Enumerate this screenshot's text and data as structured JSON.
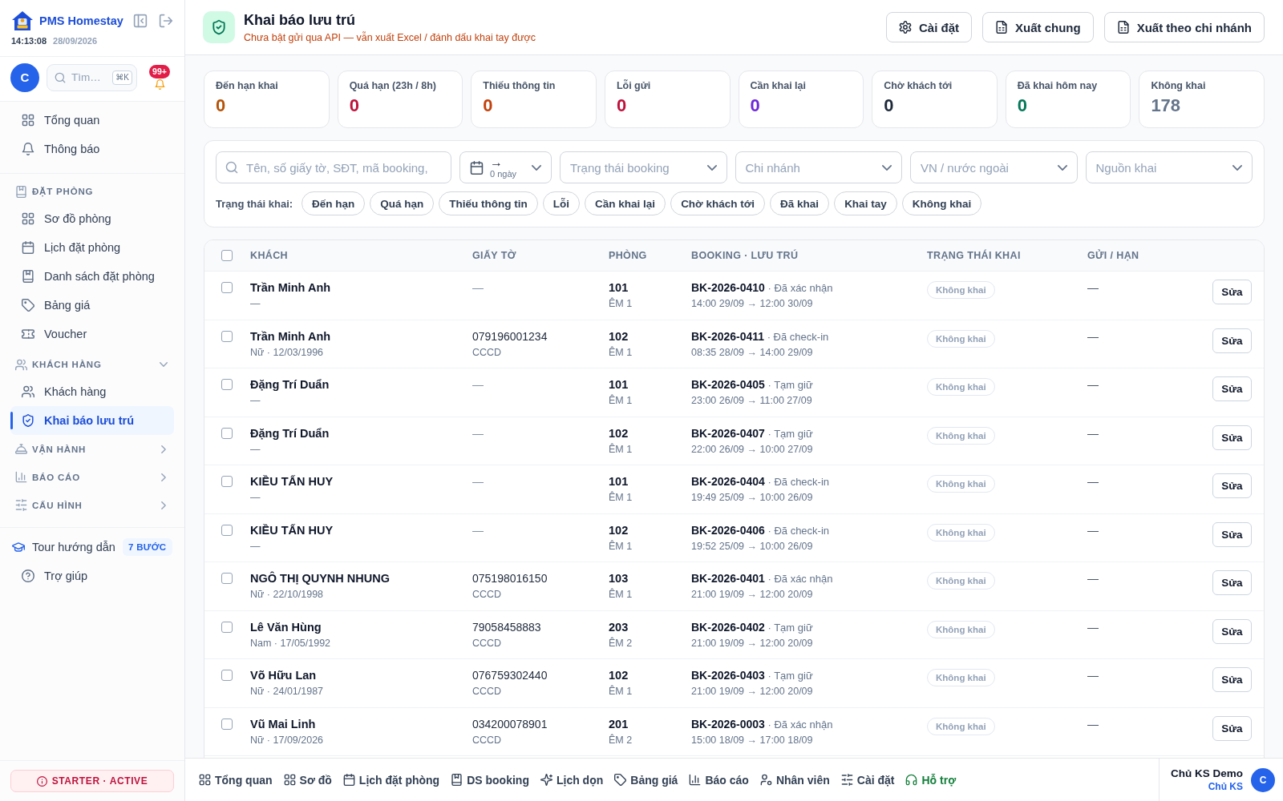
{
  "sidebar": {
    "brand": {
      "name": "PMS Homestay",
      "time": "14:13:08",
      "date": "28/09/2026"
    },
    "user": {
      "avatar": "C"
    },
    "search": {
      "placeholder": "Tìm…",
      "shortcut": "⌘K"
    },
    "notifications": {
      "badge": "99+"
    },
    "groups": [
      {
        "items": [
          {
            "label": "Tổng quan",
            "selected": false
          },
          {
            "label": "Thông báo",
            "selected": false
          }
        ]
      },
      {
        "title": "ĐẶT PHÒNG",
        "items": [
          {
            "label": "Sơ đồ phòng",
            "selected": false
          },
          {
            "label": "Lịch đặt phòng",
            "selected": false
          },
          {
            "label": "Danh sách đặt phòng",
            "selected": false
          },
          {
            "label": "Bảng giá",
            "selected": false
          },
          {
            "label": "Voucher",
            "selected": false
          }
        ]
      },
      {
        "title": "KHÁCH HÀNG",
        "expanded": true,
        "items": [
          {
            "label": "Khách hàng",
            "selected": false
          },
          {
            "label": "Khai báo lưu trú",
            "selected": true
          }
        ]
      },
      {
        "title": "VẬN HÀNH",
        "expanded": false
      },
      {
        "title": "BÁO CÁO",
        "expanded": false
      },
      {
        "title": "CẤU HÌNH",
        "expanded": false
      }
    ],
    "tour": {
      "label": "Tour hướng dẫn",
      "badge": "7 BƯỚC"
    },
    "help": {
      "label": "Trợ giúp"
    },
    "plan": {
      "label": "STARTER · ACTIVE"
    }
  },
  "header": {
    "title": "Khai báo lưu trú",
    "subtitle": "Chưa bật gửi qua API — vẫn xuất Excel / đánh dấu khai tay được",
    "buttons": [
      {
        "label": "Cài đặt",
        "kind": "settings"
      },
      {
        "label": "Xuất chung",
        "kind": "export"
      },
      {
        "label": "Xuất theo chi nhánh",
        "kind": "export"
      }
    ]
  },
  "stats": [
    {
      "label": "Đến hạn khai",
      "value": "0",
      "color": "#b45309"
    },
    {
      "label": "Quá hạn (23h / 8h)",
      "value": "0",
      "color": "#be123c"
    },
    {
      "label": "Thiếu thông tin",
      "value": "0",
      "color": "#c2410c"
    },
    {
      "label": "Lỗi gửi",
      "value": "0",
      "color": "#be123c"
    },
    {
      "label": "Cần khai lại",
      "value": "0",
      "color": "#6d28d9"
    },
    {
      "label": "Chờ khách tới",
      "value": "0",
      "color": "#1e293b"
    },
    {
      "label": "Đã khai hôm nay",
      "value": "0",
      "color": "#047857"
    },
    {
      "label": "Không khai",
      "value": "178",
      "color": "#64748b"
    }
  ],
  "filters": {
    "search": {
      "placeholder": "Tên, số giấy tờ, SĐT, mã booking,"
    },
    "date_range": {
      "arrow": "→",
      "value": "0 ngày"
    },
    "selects": [
      {
        "placeholder": "Trạng thái booking"
      },
      {
        "placeholder": "Chi nhánh"
      },
      {
        "placeholder": "VN / nước ngoài"
      },
      {
        "placeholder": "Nguồn khai"
      }
    ],
    "status_label": "Trạng thái khai:",
    "status_chips": [
      {
        "label": "Đến hạn",
        "selected": false
      },
      {
        "label": "Quá hạn",
        "selected": false
      },
      {
        "label": "Thiếu thông tin",
        "selected": false
      },
      {
        "label": "Lỗi",
        "selected": false
      },
      {
        "label": "Cần khai lại",
        "selected": false
      },
      {
        "label": "Chờ khách tới",
        "selected": false
      },
      {
        "label": "Đã khai",
        "selected": false
      },
      {
        "label": "Khai tay",
        "selected": false
      },
      {
        "label": "Không khai",
        "selected": false
      }
    ]
  },
  "table": {
    "select_all": {
      "selected": false
    },
    "columns": [
      "KHÁCH",
      "GIẤY TỜ",
      "PHÒNG",
      "BOOKING · LƯU TRÚ",
      "TRẠNG THÁI KHAI",
      "GỬI / HẠN"
    ],
    "rows": [
      {
        "selected": false,
        "guest": {
          "name": "Trần Minh Anh",
          "detail": "—"
        },
        "document": {
          "number": "—",
          "missing": true
        },
        "room": {
          "number": "101",
          "nights": "ÊM 1"
        },
        "booking": {
          "summary": "**BK-2026-0410** · Đã xác nhận",
          "stay": "14:00 29/09 → 12:00 30/09"
        },
        "status": {
          "label": "Không khai",
          "kind": "none"
        },
        "sent": "—",
        "action": "Sửa"
      },
      {
        "selected": false,
        "guest": {
          "name": "Trần Minh Anh",
          "detail": "Nữ · 12/03/1996"
        },
        "document": {
          "number": "079196001234",
          "type": "CCCD",
          "missing": false
        },
        "room": {
          "number": "102",
          "nights": "ÊM 1"
        },
        "booking": {
          "summary": "**BK-2026-0411** · Đã check-in",
          "stay": "08:35 28/09 → 14:00 29/09"
        },
        "status": {
          "label": "Không khai",
          "kind": "none"
        },
        "sent": "—",
        "action": "Sửa"
      },
      {
        "selected": false,
        "guest": {
          "name": "Đặng Trí Duẩn",
          "detail": "—"
        },
        "document": {
          "number": "—",
          "missing": true
        },
        "room": {
          "number": "101",
          "nights": "ÊM 1"
        },
        "booking": {
          "summary": "**BK-2026-0405** · Tạm giữ",
          "stay": "23:00 26/09 → 11:00 27/09"
        },
        "status": {
          "label": "Không khai",
          "kind": "none"
        },
        "sent": "—",
        "action": "Sửa"
      },
      {
        "selected": false,
        "guest": {
          "name": "Đặng Trí Duẩn",
          "detail": "—"
        },
        "document": {
          "number": "—",
          "missing": true
        },
        "room": {
          "number": "102",
          "nights": "ÊM 1"
        },
        "booking": {
          "summary": "**BK-2026-0407** · Tạm giữ",
          "stay": "22:00 26/09 → 10:00 27/09"
        },
        "status": {
          "label": "Không khai",
          "kind": "none"
        },
        "sent": "—",
        "action": "Sửa"
      },
      {
        "selected": false,
        "guest": {
          "name": "KIỀU TẤN HUY",
          "detail": "—"
        },
        "document": {
          "number": "—",
          "missing": true
        },
        "room": {
          "number": "101",
          "nights": "ÊM 1"
        },
        "booking": {
          "summary": "**BK-2026-0404** · Đã check-in",
          "stay": "19:49 25/09 → 10:00 26/09"
        },
        "status": {
          "label": "Không khai",
          "kind": "none"
        },
        "sent": "—",
        "action": "Sửa"
      },
      {
        "selected": false,
        "guest": {
          "name": "KIỀU TẤN HUY",
          "detail": "—"
        },
        "document": {
          "number": "—",
          "missing": true
        },
        "room": {
          "number": "102",
          "nights": "ÊM 1"
        },
        "booking": {
          "summary": "**BK-2026-0406** · Đã check-in",
          "stay": "19:52 25/09 → 10:00 26/09"
        },
        "status": {
          "label": "Không khai",
          "kind": "none"
        },
        "sent": "—",
        "action": "Sửa"
      },
      {
        "selected": false,
        "guest": {
          "name": "NGÔ THỊ QUYNH NHUNG",
          "detail": "Nữ · 22/10/1998"
        },
        "document": {
          "number": "075198016150",
          "type": "CCCD",
          "missing": false
        },
        "room": {
          "number": "103",
          "nights": "ÊM 1"
        },
        "booking": {
          "summary": "**BK-2026-0401** · Đã xác nhận",
          "stay": "21:00 19/09 → 12:00 20/09"
        },
        "status": {
          "label": "Không khai",
          "kind": "none"
        },
        "sent": "—",
        "action": "Sửa"
      },
      {
        "selected": false,
        "guest": {
          "name": "Lê Văn Hùng",
          "detail": "Nam · 17/05/1992"
        },
        "document": {
          "number": "79058458883",
          "type": "CCCD",
          "missing": false
        },
        "room": {
          "number": "203",
          "nights": "ÊM 2"
        },
        "booking": {
          "summary": "**BK-2026-0402** · Tạm giữ",
          "stay": "21:00 19/09 → 12:00 20/09"
        },
        "status": {
          "label": "Không khai",
          "kind": "none"
        },
        "sent": "—",
        "action": "Sửa"
      },
      {
        "selected": false,
        "guest": {
          "name": "Võ Hữu Lan",
          "detail": "Nữ · 24/01/1987"
        },
        "document": {
          "number": "076759302440",
          "type": "CCCD",
          "missing": false
        },
        "room": {
          "number": "102",
          "nights": "ÊM 1"
        },
        "booking": {
          "summary": "**BK-2026-0403** · Tạm giữ",
          "stay": "21:00 19/09 → 12:00 20/09"
        },
        "status": {
          "label": "Không khai",
          "kind": "none"
        },
        "sent": "—",
        "action": "Sửa"
      },
      {
        "selected": false,
        "guest": {
          "name": "Vũ Mai Linh",
          "detail": "Nữ · 17/09/2026"
        },
        "document": {
          "number": "034200078901",
          "type": "CCCD",
          "missing": false
        },
        "room": {
          "number": "201",
          "nights": "ÊM 2"
        },
        "booking": {
          "summary": "**BK-2026-0003** · Đã xác nhận",
          "stay": "15:00 18/09 → 17:00 18/09"
        },
        "status": {
          "label": "Không khai",
          "kind": "none"
        },
        "sent": "—",
        "action": "Sửa"
      }
    ]
  },
  "bottom_nav": {
    "items": [
      {
        "label": "Tổng quan",
        "color": "#334155"
      },
      {
        "label": "Sơ đồ",
        "color": "#334155"
      },
      {
        "label": "Lịch đặt phòng",
        "color": "#334155"
      },
      {
        "label": "DS booking",
        "color": "#334155"
      },
      {
        "label": "Lịch dọn",
        "color": "#334155"
      },
      {
        "label": "Bảng giá",
        "color": "#334155"
      },
      {
        "label": "Báo cáo",
        "color": "#334155"
      },
      {
        "label": "Nhân viên",
        "color": "#334155"
      },
      {
        "label": "Cài đặt",
        "color": "#334155"
      },
      {
        "label": "Hỗ trợ",
        "color": "#15803d"
      }
    ],
    "user": {
      "name": "Chủ KS Demo",
      "role": "Chủ KS",
      "avatar": "C"
    }
  }
}
